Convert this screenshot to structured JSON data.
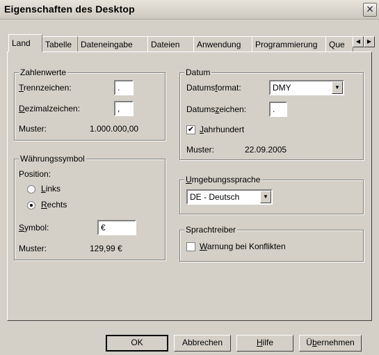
{
  "window": {
    "title": "Eigenschaften des Desktop",
    "close_glyph": "✕"
  },
  "tabs": [
    {
      "label": "Land",
      "active": true
    },
    {
      "label": "Tabelle"
    },
    {
      "label": "Dateneingabe"
    },
    {
      "label": "Dateien"
    },
    {
      "label": "Anwendung"
    },
    {
      "label": "Programmierung"
    },
    {
      "label": "Que"
    }
  ],
  "tab_scroll": {
    "left_icon": "triangle-left-icon",
    "right_icon": "triangle-right-icon"
  },
  "zahlenwerte": {
    "legend": "Zahlenwerte",
    "trenn_pre": "",
    "trenn_key": "T",
    "trenn_post": "rennzeichen:",
    "trenn_value": ".",
    "dezimal_key": "D",
    "dezimal_post": "ezimalzeichen:",
    "dezimal_value": ",",
    "muster_label": "Muster:",
    "muster_value": "1.000.000,00"
  },
  "waehrung": {
    "legend": "Währungssymbol",
    "position_label": "Position:",
    "links_key": "L",
    "links_post": "inks",
    "rechts_key": "R",
    "rechts_post": "echts",
    "selected": "rechts",
    "symbol_key": "S",
    "symbol_post": "ymbol:",
    "symbol_value": "€",
    "muster_label": "Muster:",
    "muster_value": "129,99 €"
  },
  "datum": {
    "legend": "Datum",
    "format_pre": "Datums",
    "format_key": "f",
    "format_post": "ormat:",
    "format_value": "DMY",
    "zeichen_pre": "Datums",
    "zeichen_key": "z",
    "zeichen_post": "eichen:",
    "zeichen_value": ".",
    "jahrhundert_key": "J",
    "jahrhundert_post": "ahrhundert",
    "jahrhundert_checked": true,
    "check_glyph": "✔",
    "muster_label": "Muster:",
    "muster_value": "22.09.2005"
  },
  "umgebung": {
    "legend_key": "U",
    "legend_post": "mgebungssprache",
    "value": "DE - Deutsch"
  },
  "sprachtreiber": {
    "legend": "Sprachtreiber",
    "warnung_key": "W",
    "warnung_post": "arnung bei Konflikten",
    "warnung_checked": false
  },
  "buttons": {
    "ok": "OK",
    "abbrechen": "Abbrechen",
    "hilfe_key": "H",
    "hilfe_post": "ilfe",
    "uebernehmen_pre": "Ü",
    "uebernehmen_key": "b",
    "uebernehmen_post": "ernehmen"
  },
  "combo_arrow_glyph": "▼",
  "scroll_left_glyph": "◀",
  "scroll_right_glyph": "▶"
}
